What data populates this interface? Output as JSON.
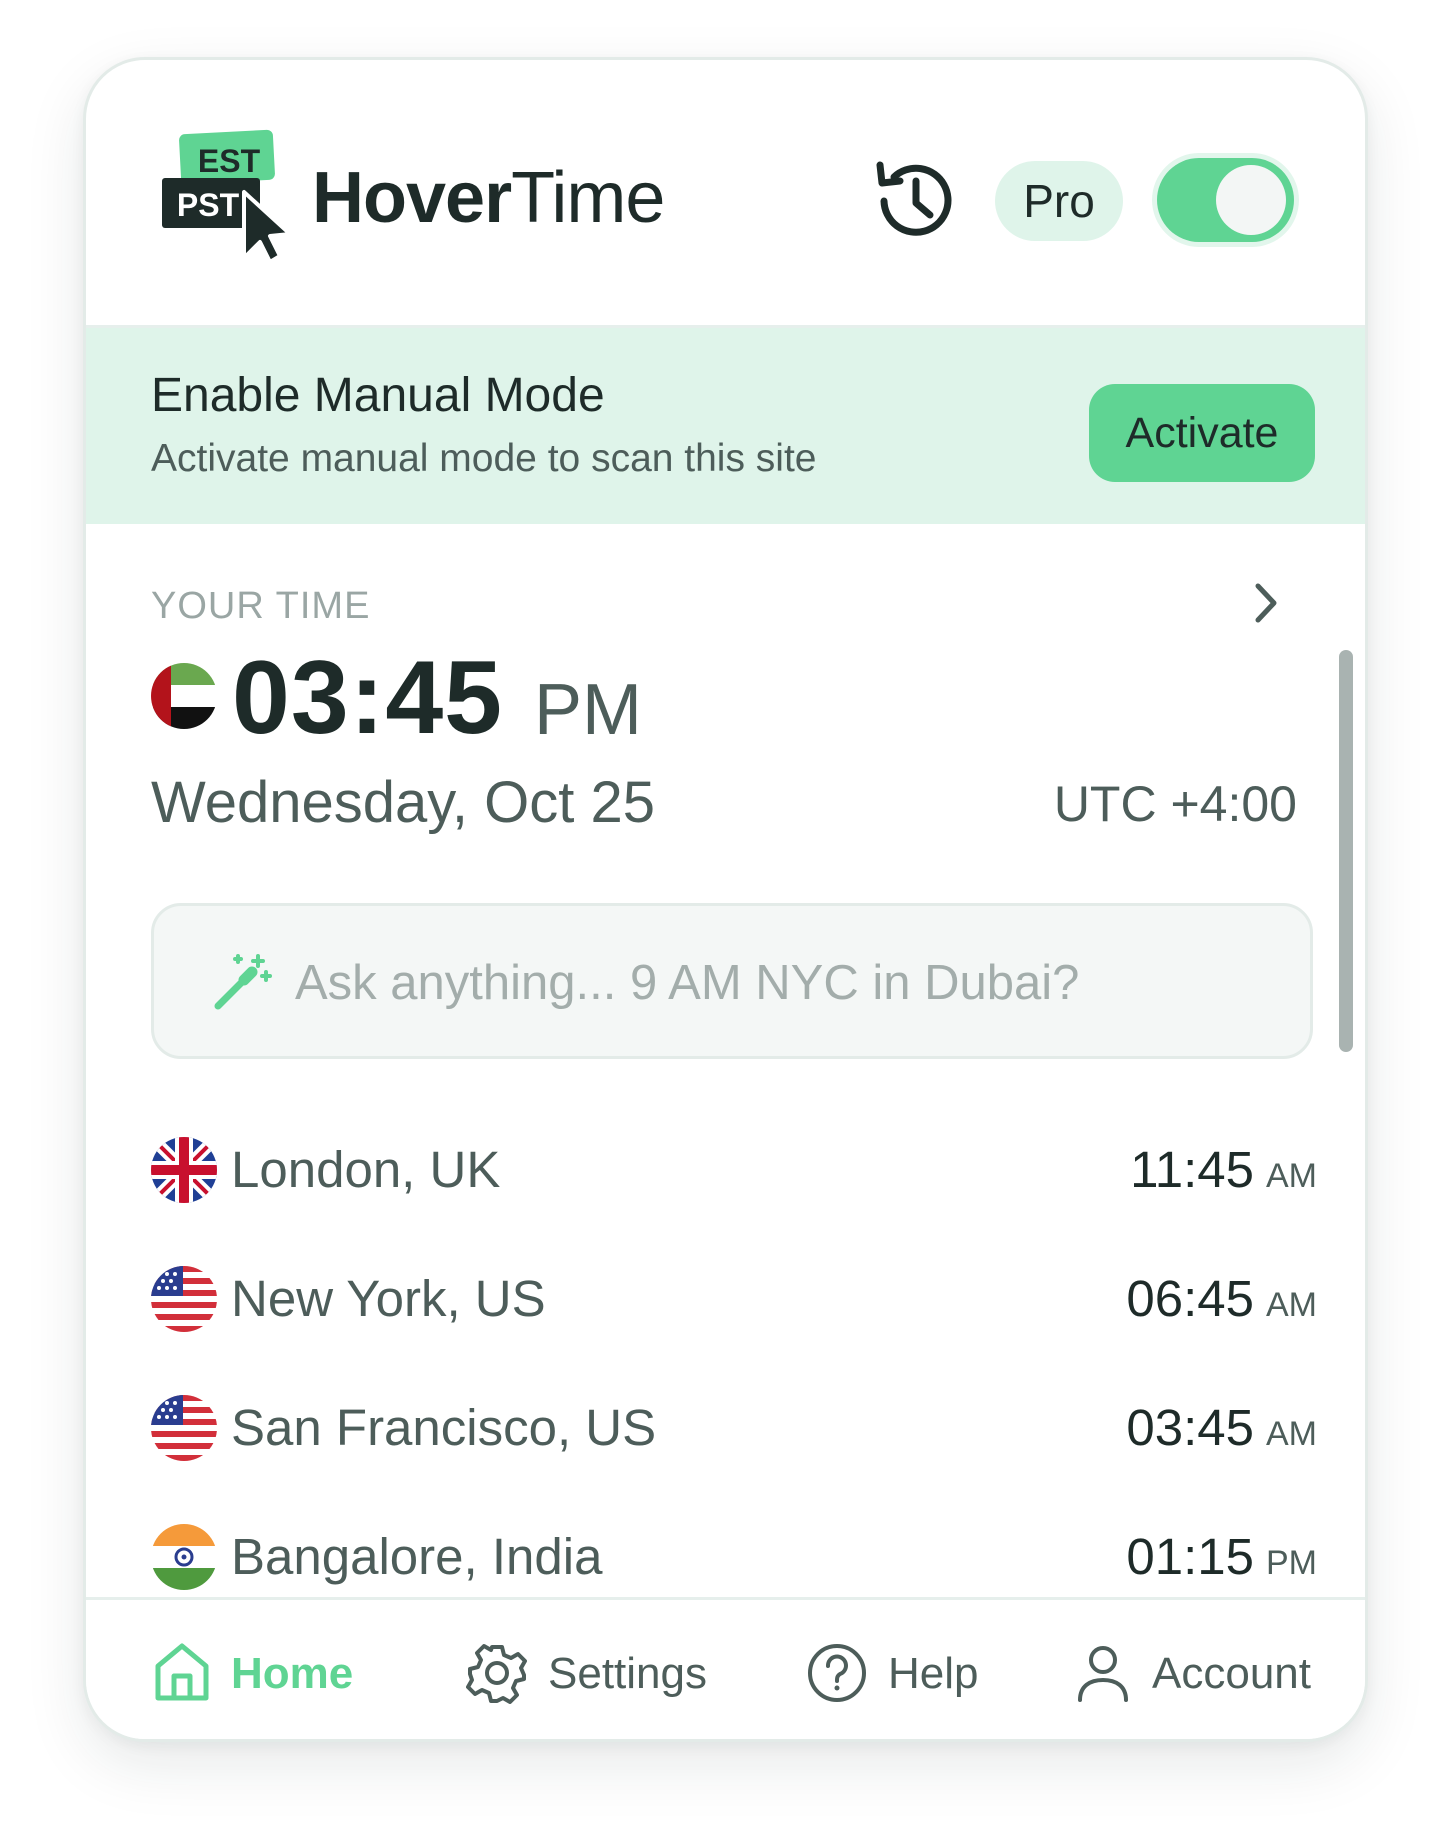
{
  "header": {
    "logo": {
      "top_badge": "EST",
      "bottom_badge": "PST"
    },
    "brand_bold": "Hover",
    "brand_light": "Time",
    "history_icon": "history-icon",
    "pro_label": "Pro",
    "toggle_on": true
  },
  "colors": {
    "accent": "#5fd493",
    "accent_light": "#dff4ea",
    "text_dark": "#1e2b29",
    "text_muted": "#4d5d5a"
  },
  "banner": {
    "title": "Enable Manual Mode",
    "subtitle": "Activate manual mode to scan this site",
    "button_label": "Activate"
  },
  "your_time": {
    "label": "YOUR TIME",
    "flag": "uae-flag",
    "time": "03:45",
    "ampm": "PM",
    "date": "Wednesday, Oct 25",
    "utc": "UTC +4:00"
  },
  "ask": {
    "placeholder": "Ask anything... 9 AM NYC in Dubai?",
    "icon": "magic-wand-icon"
  },
  "cities": [
    {
      "name": "London, UK",
      "time": "11:45",
      "ampm": "AM",
      "flag": "uk-flag"
    },
    {
      "name": "New York, US",
      "time": "06:45",
      "ampm": "AM",
      "flag": "us-flag"
    },
    {
      "name": "San Francisco, US",
      "time": "03:45",
      "ampm": "AM",
      "flag": "us-flag"
    },
    {
      "name": "Bangalore, India",
      "time": "01:15",
      "ampm": "PM",
      "flag": "india-flag"
    }
  ],
  "nav": {
    "home": "Home",
    "settings": "Settings",
    "help": "Help",
    "account": "Account",
    "active": "home"
  }
}
